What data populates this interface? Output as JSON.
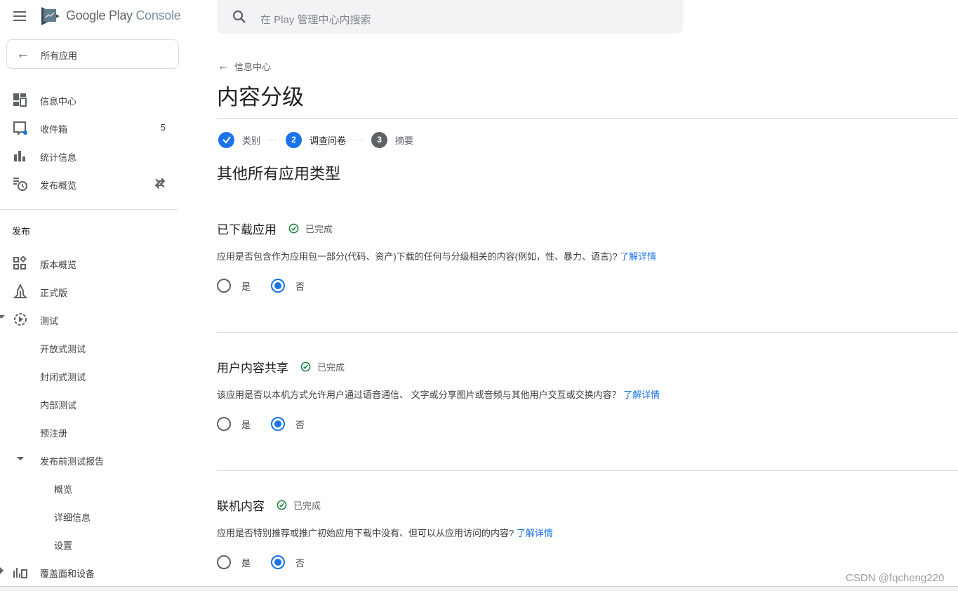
{
  "header": {
    "brand_primary": "Google Play",
    "brand_secondary": "Console",
    "search_placeholder": "在 Play 管理中心内搜索"
  },
  "sidebar": {
    "all_apps_label": "所有应用",
    "top_items": [
      {
        "label": "信息中心",
        "icon": "dashboard-icon"
      },
      {
        "label": "收件箱",
        "icon": "inbox-icon",
        "badge": "5"
      },
      {
        "label": "统计信息",
        "icon": "bar-chart-icon"
      },
      {
        "label": "发布概览",
        "icon": "publishing-overview-icon",
        "trailing_icon": "sync-disabled-icon"
      }
    ],
    "section_label": "发布",
    "release_items": [
      {
        "label": "版本概览",
        "icon": "release-overview-icon"
      },
      {
        "label": "正式版",
        "icon": "production-icon"
      },
      {
        "label": "测试",
        "icon": "testing-icon",
        "expanded": true
      }
    ],
    "testing_children": [
      "开放式测试",
      "封闭式测试",
      "内部测试",
      "预注册"
    ],
    "pre_launch": {
      "label": "发布前测试报告",
      "expanded": true,
      "children": [
        "概览",
        "详细信息",
        "设置"
      ]
    },
    "coverage": {
      "label": "覆盖面和设备",
      "icon": "coverage-icon",
      "expanded": false
    }
  },
  "main": {
    "back_label": "信息中心",
    "page_title": "内容分级",
    "steps": [
      {
        "number": "1",
        "label": "类别",
        "state": "completed"
      },
      {
        "number": "2",
        "label": "调查问卷",
        "state": "active"
      },
      {
        "number": "3",
        "label": "摘要",
        "state": "upcoming"
      }
    ],
    "subtitle": "其他所有应用类型",
    "questions": [
      {
        "title": "已下载应用",
        "status": "已完成",
        "description": "应用是否包含作为应用包一部分(代码、资产)下载的任何与分级相关的内容(例如，性、暴力、语言)? ",
        "link": "了解详情",
        "options": [
          "是",
          "否"
        ],
        "selected": "否"
      },
      {
        "title": "用户内容共享",
        "status": "已完成",
        "description": "该应用是否以本机方式允许用户通过语音通信、 文字或分享图片或音频与其他用户交互或交换内容？ ",
        "link": "了解详情",
        "options": [
          "是",
          "否"
        ],
        "selected": "否"
      },
      {
        "title": "联机内容",
        "status": "已完成",
        "description": "应用是否特别推荐或推广初始应用下载中没有、但可以从应用访问的内容? ",
        "link": "了解详情",
        "options": [
          "是",
          "否"
        ],
        "selected": "否"
      }
    ]
  },
  "colors": {
    "accent": "#1a73e8",
    "success": "#188038",
    "step_upcoming": "#5f6368"
  },
  "watermark": "CSDN @fqcheng220"
}
